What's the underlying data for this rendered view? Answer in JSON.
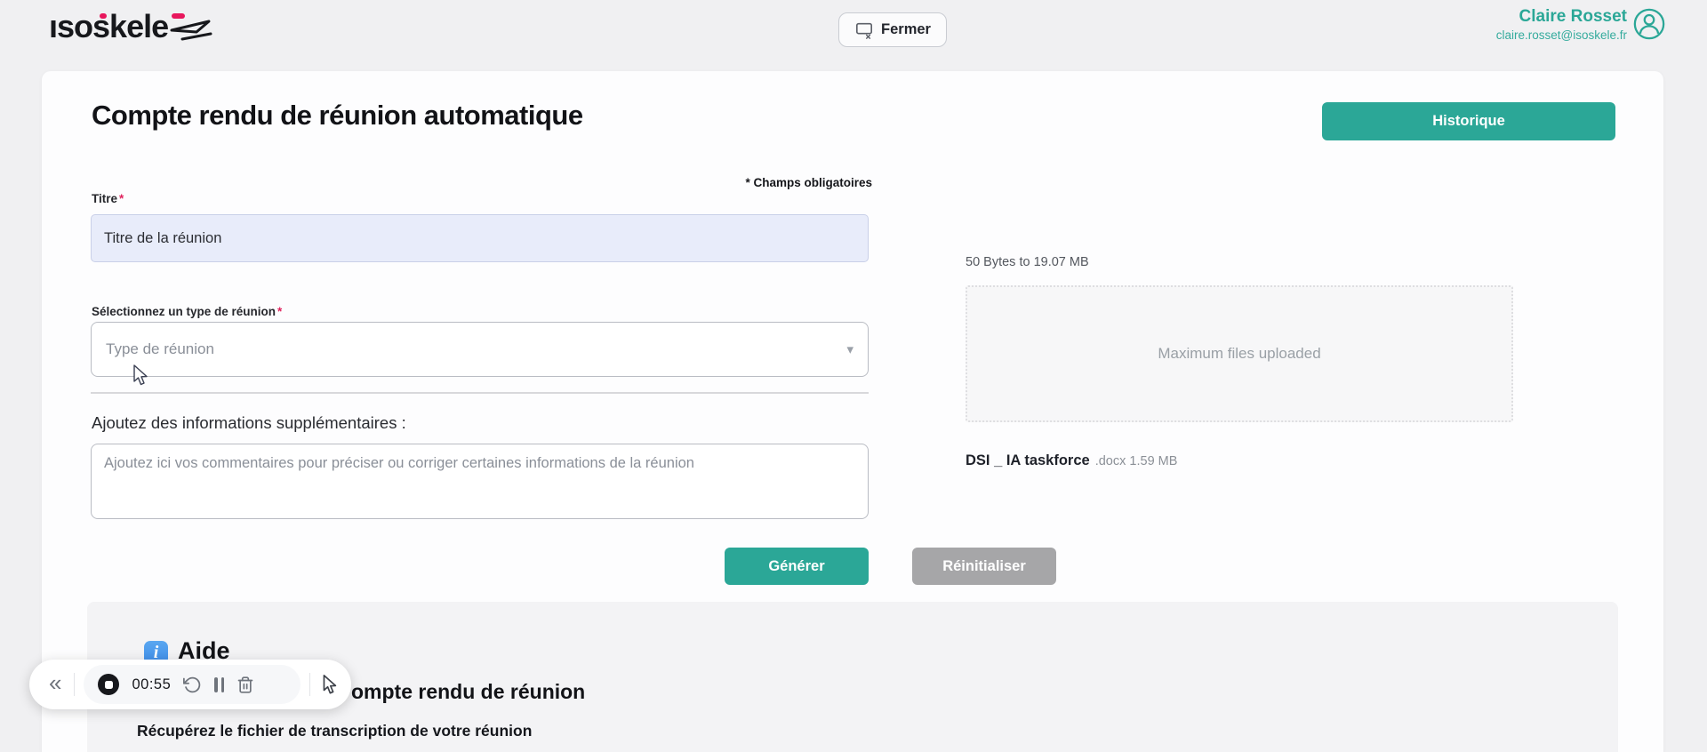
{
  "colors": {
    "accent_teal": "#2BA797",
    "accent_pink": "#E8175D",
    "info_blue": "#4D9FEB",
    "input_filled_bg": "#E8ECFA",
    "reset_gray": "#A6A6A8"
  },
  "header": {
    "logo_text": "isoskēle",
    "logo_seg_a": "ısosk",
    "logo_seg_e": "e",
    "logo_seg_b": "le",
    "close_button": "Fermer",
    "user": {
      "name": "Claire Rosset",
      "email": "claire.rosset@isoskele.fr"
    }
  },
  "main": {
    "title": "Compte rendu de réunion automatique",
    "history_button": "Historique",
    "required_note": "* Champs obligatoires",
    "form": {
      "title_label": "Titre",
      "required_mark": "*",
      "title_value": "Titre de la réunion",
      "type_label": "Sélectionnez un type de réunion",
      "type_placeholder": "Type de réunion",
      "comments_label": "Ajoutez des informations supplémentaires :",
      "comments_placeholder": "Ajoutez ici vos commentaires pour préciser ou corriger certaines informations de la réunion",
      "generate_button": "Générer",
      "reset_button": "Réinitialiser"
    },
    "upload": {
      "size_hint": "50 Bytes to 19.07 MB",
      "dropzone_text": "Maximum files uploaded",
      "file": {
        "name": "DSI _ IA taskforce",
        "ext": ".docx",
        "size": "1.59 MB"
      }
    },
    "help": {
      "heading": "Aide",
      "step_fragment": "ompte rendu de réunion",
      "step_sub": "Récupérez le fichier de transcription de votre réunion"
    }
  },
  "toolbar": {
    "time": "00:55"
  },
  "icons": {
    "collapse_glyph": "«",
    "select_chevron_glyph": "▾",
    "info_glyph": "i"
  }
}
